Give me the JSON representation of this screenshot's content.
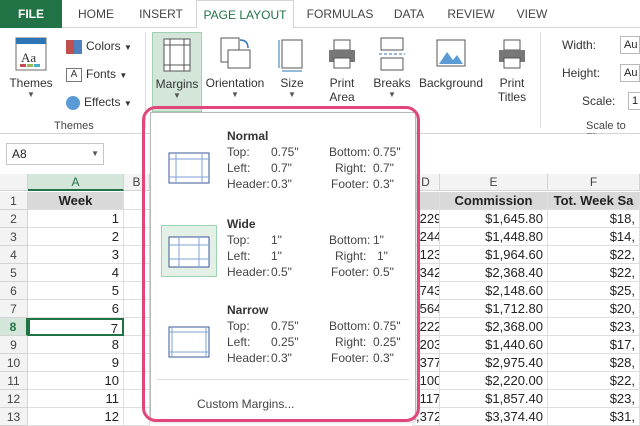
{
  "tabs": [
    {
      "label": "FILE"
    },
    {
      "label": "HOME"
    },
    {
      "label": "INSERT"
    },
    {
      "label": "PAGE LAYOUT"
    },
    {
      "label": "FORMULAS"
    },
    {
      "label": "DATA"
    },
    {
      "label": "REVIEW"
    },
    {
      "label": "VIEW"
    }
  ],
  "ribbon": {
    "themes": {
      "label": "Themes",
      "group": "Themes"
    },
    "colors": "Colors",
    "fonts": "Fonts",
    "effects": "Effects",
    "margins": "Margins",
    "orientation": "Orientation",
    "size": "Size",
    "print_area_1": "Print",
    "print_area_2": "Area",
    "breaks": "Breaks",
    "background": "Background",
    "print_titles_1": "Print",
    "print_titles_2": "Titles",
    "width": "Width:",
    "height": "Height:",
    "scale": "Scale:",
    "width_val": "Au",
    "height_val": "Au",
    "scale_val": "1",
    "scale_group": "Scale to Fit"
  },
  "formula_bar": {
    "name_box": "A8"
  },
  "columns": [
    {
      "label": ""
    },
    {
      "label": "A"
    },
    {
      "label": "B"
    },
    {
      "label": "C"
    },
    {
      "label": "D"
    },
    {
      "label": "E"
    },
    {
      "label": "F"
    }
  ],
  "rows": [
    "1",
    "2",
    "3",
    "4",
    "5",
    "6",
    "7",
    "8",
    "9",
    "10",
    "11",
    "12",
    "13"
  ],
  "table": {
    "header_a": "Week",
    "header_e": "Commission",
    "header_f": "Tot. Week Sa",
    "weeks": [
      "1",
      "2",
      "3",
      "4",
      "5",
      "6",
      "7",
      "8",
      "9",
      "10",
      "11",
      "12"
    ],
    "col_d": [
      ",229",
      ",244",
      ",123",
      ",342",
      ",743",
      ",564",
      ",222",
      ",203",
      ",377",
      ",100",
      ",117",
      ",372"
    ],
    "commission": [
      "$1,645.80",
      "$1,448.80",
      "$1,964.60",
      "$2,368.40",
      "$2,148.60",
      "$1,712.80",
      "$2,368.00",
      "$1,440.60",
      "$2,975.40",
      "$2,220.00",
      "$1,857.40",
      "$3,374.40"
    ],
    "tot_week": [
      "$18,",
      "$14,",
      "$22,",
      "$22,",
      "$25,",
      "$20,",
      "$23,",
      "$17,",
      "$28,",
      "$22,",
      "$23,",
      "$31,"
    ]
  },
  "margins_menu": {
    "options": [
      {
        "name": "Normal",
        "top_label": "Top:",
        "top": "0.75\"",
        "bottom_label": "Bottom:",
        "bottom": "0.75\"",
        "left_label": "Left:",
        "left": "0.7\"",
        "right_label": "Right:",
        "right": "0.7\"",
        "header_label": "Header:",
        "header": "0.3\"",
        "footer_label": "Footer:",
        "footer": "0.3\""
      },
      {
        "name": "Wide",
        "top_label": "Top:",
        "top": "1\"",
        "bottom_label": "Bottom:",
        "bottom": "1\"",
        "left_label": "Left:",
        "left": "1\"",
        "right_label": "Right:",
        "right": "1\"",
        "header_label": "Header:",
        "header": "0.5\"",
        "footer_label": "Footer:",
        "footer": "0.5\""
      },
      {
        "name": "Narrow",
        "top_label": "Top:",
        "top": "0.75\"",
        "bottom_label": "Bottom:",
        "bottom": "0.75\"",
        "left_label": "Left:",
        "left": "0.25\"",
        "right_label": "Right:",
        "right": "0.25\"",
        "header_label": "Header:",
        "header": "0.3\"",
        "footer_label": "Footer:",
        "footer": "0.3\""
      }
    ],
    "custom": "Custom Margins..."
  },
  "colors": {
    "accent": "#217346",
    "highlight": "#e0457b"
  }
}
